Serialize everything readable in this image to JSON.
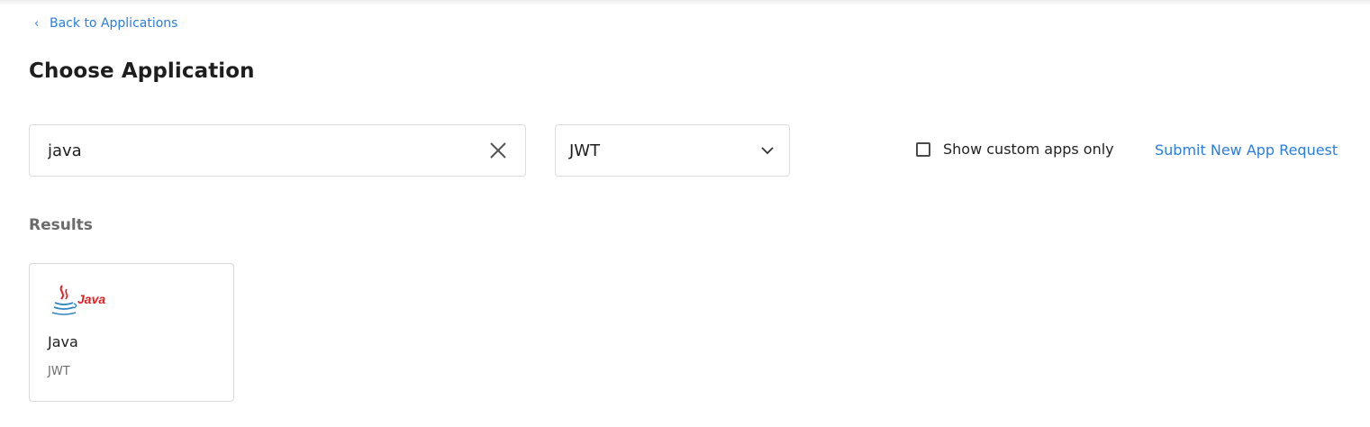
{
  "nav": {
    "back_label": "Back to Applications"
  },
  "page": {
    "title": "Choose Application"
  },
  "filters": {
    "search_value": "java",
    "protocol_selected": "JWT",
    "custom_only_label": "Show custom apps only",
    "custom_only_checked": false,
    "submit_request_label": "Submit New App Request"
  },
  "results": {
    "label": "Results",
    "items": [
      {
        "logo_text": "Java",
        "name": "Java",
        "type": "JWT"
      }
    ]
  },
  "colors": {
    "accent": "#2a7de1",
    "java_red": "#e11f22",
    "java_blue": "#2f86c4"
  }
}
